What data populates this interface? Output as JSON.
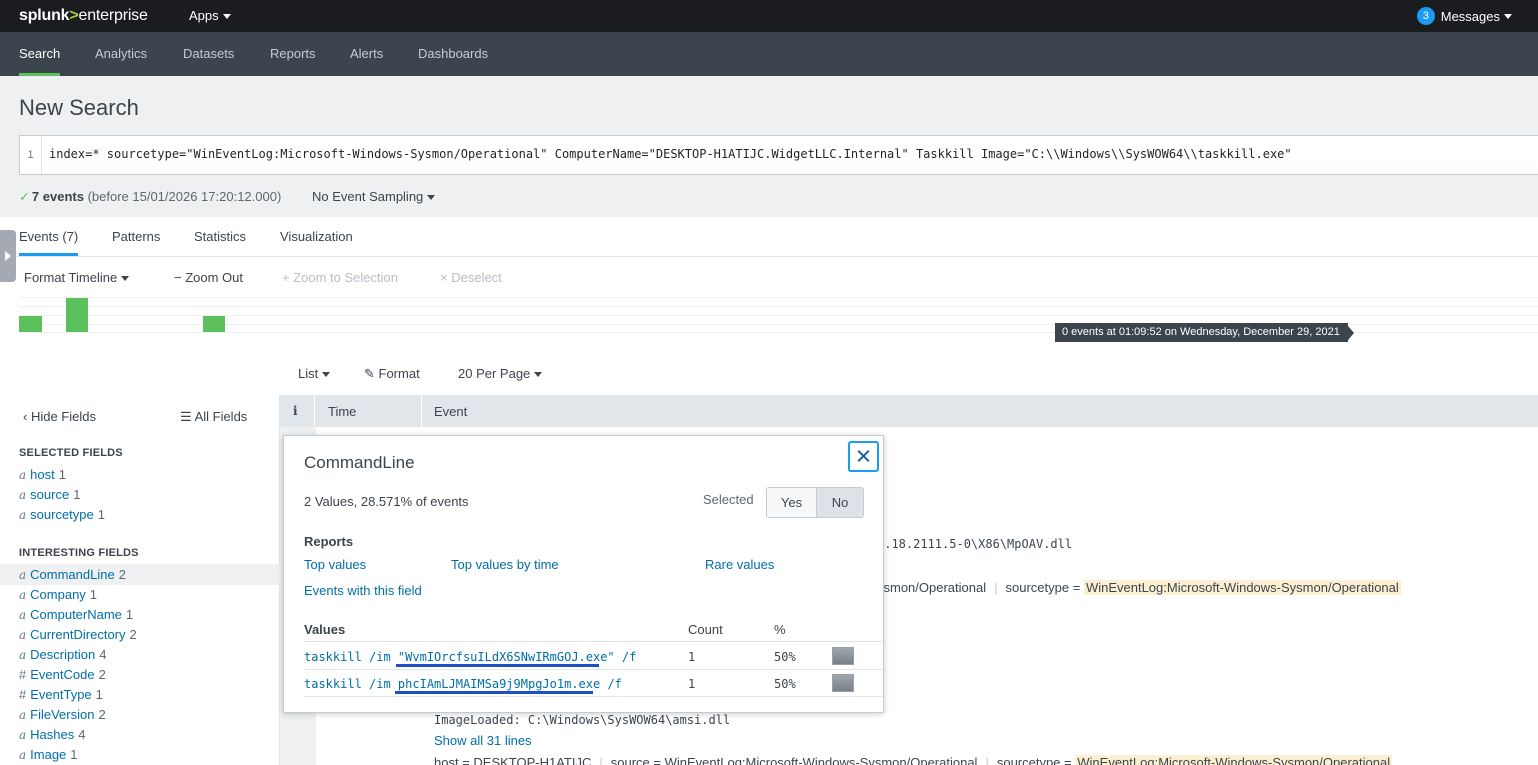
{
  "topbar": {
    "logo_splunk": "splunk",
    "logo_gt": ">",
    "logo_enterprise": "enterprise",
    "apps_label": "Apps",
    "messages_count": "3",
    "messages_label": "Messages"
  },
  "appbar": {
    "tabs": [
      "Search",
      "Analytics",
      "Datasets",
      "Reports",
      "Alerts",
      "Dashboards"
    ],
    "active": "Search"
  },
  "search": {
    "title": "New Search",
    "line_number": "1",
    "query": "index=* sourcetype=\"WinEventLog:Microsoft-Windows-Sysmon/Operational\" ComputerName=\"DESKTOP-H1ATIJC.WidgetLLC.Internal\" Taskkill Image=\"C:\\\\Windows\\\\SysWOW64\\\\taskkill.exe\"",
    "status_check": "✓",
    "status_count": "7 events",
    "status_detail": "(before 15/01/2026 17:20:12.000)",
    "sampling": "No Event Sampling"
  },
  "result_tabs": [
    "Events (7)",
    "Patterns",
    "Statistics",
    "Visualization"
  ],
  "timeline": {
    "format": "Format Timeline",
    "zoom_out": "Zoom Out",
    "zoom_sel": "Zoom to Selection",
    "deselect": "Deselect",
    "tooltip": "0 events at 01:09:52 on Wednesday, December 29, 2021",
    "bar_color": "#5cc05c"
  },
  "results_controls": {
    "list": "List",
    "format": "Format",
    "per_page": "20 Per Page"
  },
  "sidebar": {
    "hide_fields": "Hide Fields",
    "all_fields": "All Fields",
    "selected_header": "SELECTED FIELDS",
    "interesting_header": "INTERESTING FIELDS",
    "selected": [
      {
        "type": "a",
        "name": "host",
        "count": "1"
      },
      {
        "type": "a",
        "name": "source",
        "count": "1"
      },
      {
        "type": "a",
        "name": "sourcetype",
        "count": "1"
      }
    ],
    "interesting": [
      {
        "type": "a",
        "name": "CommandLine",
        "count": "2"
      },
      {
        "type": "a",
        "name": "Company",
        "count": "1"
      },
      {
        "type": "a",
        "name": "ComputerName",
        "count": "1"
      },
      {
        "type": "a",
        "name": "CurrentDirectory",
        "count": "2"
      },
      {
        "type": "a",
        "name": "Description",
        "count": "4"
      },
      {
        "type": "#",
        "name": "EventCode",
        "count": "2"
      },
      {
        "type": "#",
        "name": "EventType",
        "count": "1"
      },
      {
        "type": "a",
        "name": "FileVersion",
        "count": "2"
      },
      {
        "type": "a",
        "name": "Hashes",
        "count": "4"
      },
      {
        "type": "a",
        "name": "Image",
        "count": "1"
      }
    ]
  },
  "table": {
    "info": "i",
    "time": "Time",
    "event": "Event"
  },
  "events": {
    "line1": "4.18.2111.5-0\\X86\\MpOAV.dll",
    "line2_a": "ysmon/Operational",
    "line2_key": "sourcetype =",
    "line2_val": "WinEventLog:Microsoft-Windows-Sysmon/Operational",
    "image_loaded": "ImageLoaded: C:\\Windows\\SysWOW64\\amsi.dll",
    "show_all": "Show all 31 lines",
    "last_host": "host = DESKTOP-H1ATIJC",
    "last_source": "source = WinEventLog:Microsoft-Windows-Sysmon/Operational",
    "last_st_key": "sourcetype =",
    "last_st_val": "WinEventLog:Microsoft-Windows-Sysmon/Operational"
  },
  "popup": {
    "title": "CommandLine",
    "summary": "2 Values, 28.571% of events",
    "selected_label": "Selected",
    "yes": "Yes",
    "no": "No",
    "reports_label": "Reports",
    "top_values": "Top values",
    "top_values_time": "Top values by time",
    "rare_values": "Rare values",
    "events_with_field": "Events with this field",
    "col_values": "Values",
    "col_count": "Count",
    "col_pct": "%",
    "rows": [
      {
        "prefix": "taskkill /im ",
        "value": "\"WvmIOrcfsuILdX6SNwIRmGOJ.exe\"",
        "suffix": " /f",
        "count": "1",
        "pct": "50%"
      },
      {
        "prefix": "taskkill /im ",
        "value": "phcIAmLJMAIMSa9j9MpgJo1m.exe",
        "suffix": " /f",
        "count": "1",
        "pct": "50%"
      }
    ]
  }
}
